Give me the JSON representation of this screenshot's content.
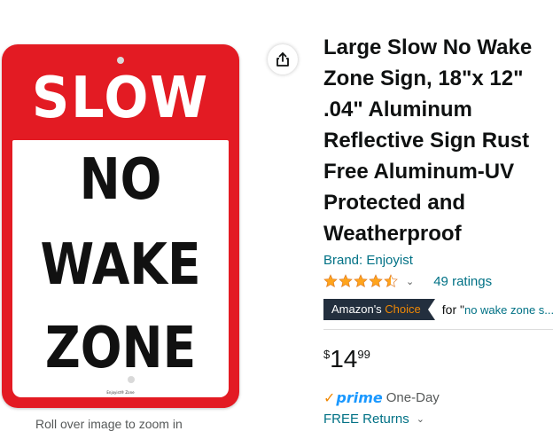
{
  "product": {
    "title": "Large Slow No Wake Zone Sign, 18\"x 12\" .04\" Aluminum Reflective Sign Rust Free Aluminum-UV Protected and Weatherproof",
    "brand_link": "Brand: Enjoyist",
    "rating_stars": 4.5,
    "ratings_count": "49 ratings",
    "badge": {
      "prefix": "Amazon's ",
      "accent": "Choice"
    },
    "badge_for": "for \"",
    "badge_query": "no wake zone s...",
    "price": {
      "symbol": "$",
      "whole": "14",
      "fraction": "99"
    },
    "prime": {
      "check": "✓",
      "word": "prime",
      "delivery": "One-Day"
    },
    "returns": "FREE Returns"
  },
  "image": {
    "sign_top": "SLOW",
    "sign_lines": [
      "NO",
      "WAKE",
      "ZONE"
    ],
    "sign_brand": "Enjoyist® Zone",
    "zoom_caption": "Roll over image to zoom in"
  },
  "colors": {
    "sign_red": "#e31b23",
    "link": "#007185",
    "star": "#ffa41c",
    "badge_bg": "#232f3e",
    "badge_accent": "#f08804",
    "prime_blue": "#1a98ff"
  },
  "icons": {
    "share": "share-icon",
    "star": "star-icon",
    "chevron": "chevron-down-icon"
  }
}
